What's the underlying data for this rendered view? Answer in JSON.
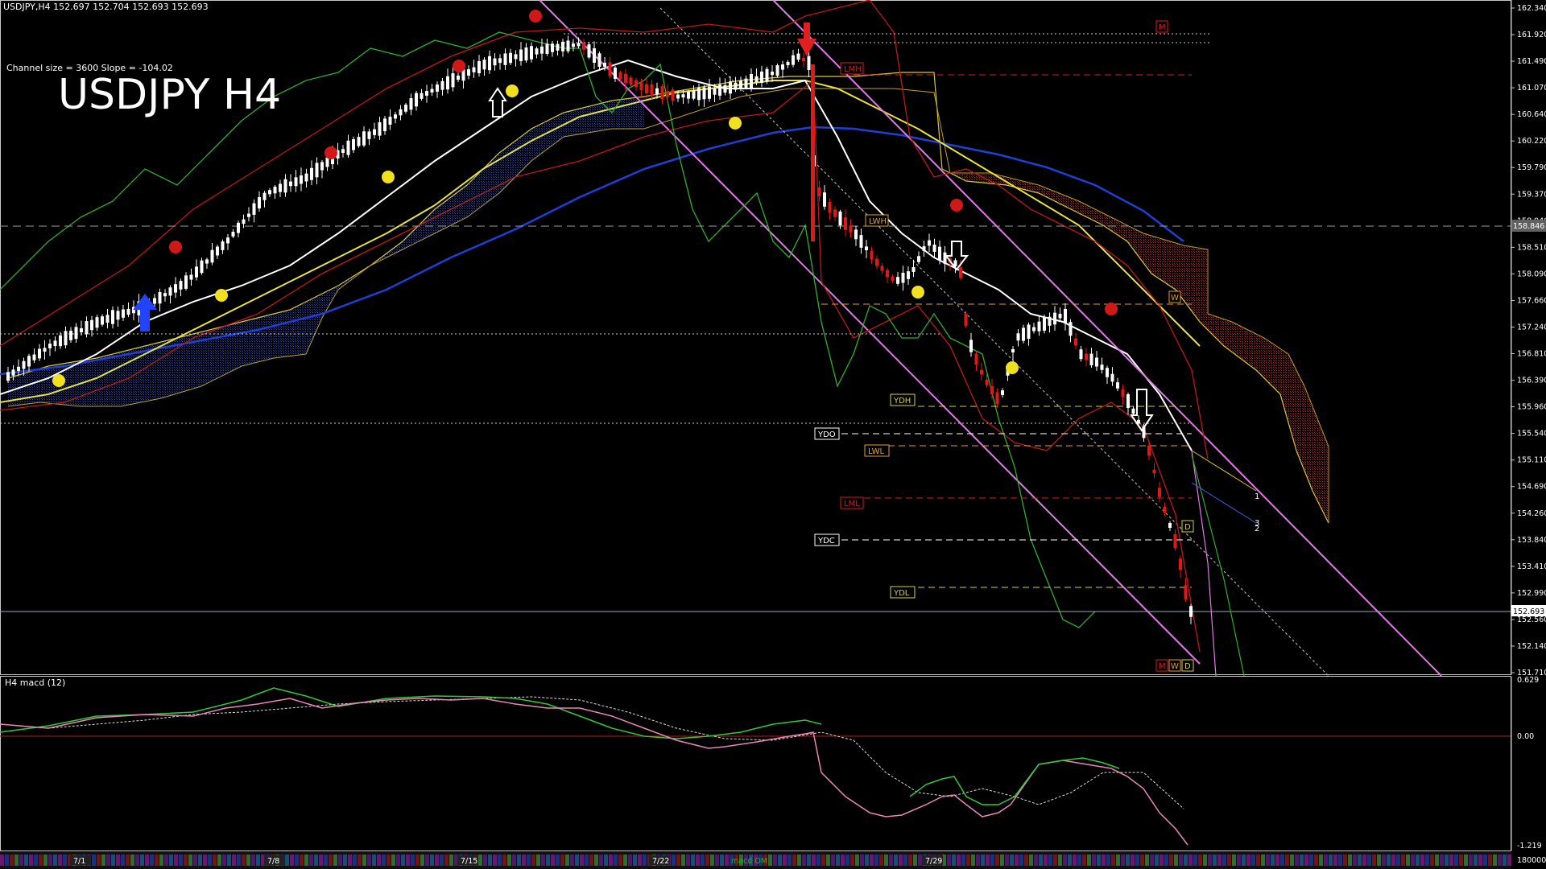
{
  "header": {
    "title_line": "USDJPY,H4  152.697 152.704 152.693 152.693",
    "channel_info": "Channel size = 3600 Slope = -104.02",
    "big_title": "USDJPY H4"
  },
  "price_axis": {
    "ticks": [
      "162.340",
      "161.920",
      "161.490",
      "161.070",
      "160.640",
      "160.220",
      "159.790",
      "159.370",
      "158.940",
      "158.510",
      "158.090",
      "157.660",
      "157.240",
      "156.810",
      "156.390",
      "155.960",
      "155.540",
      "155.110",
      "154.690",
      "154.260",
      "153.840",
      "153.410",
      "152.990",
      "152.560",
      "152.140",
      "151.710"
    ],
    "current_price": "152.693",
    "hline_price": "158.846"
  },
  "macd_panel": {
    "title": "H4  macd (12)",
    "ticks": [
      "0.629",
      "0.00",
      "-1.219",
      "180000"
    ],
    "footer_label": "macd OM"
  },
  "time_axis": {
    "labels": [
      "7/1",
      "7/8",
      "7/15",
      "7/22",
      "7/29"
    ]
  },
  "level_labels": {
    "lmh": "LMH",
    "lwh": "LWH",
    "ydh": "YDH",
    "ydo": "YDO",
    "lwl": "LWL",
    "lml": "LML",
    "ydc": "YDC",
    "ydl": "YDL",
    "m_top": "M",
    "w_right": "W",
    "d_right": "D",
    "m_bottom": "M",
    "w_bottom": "W",
    "d_bottom": "D",
    "num_1": "1",
    "num_2": "2",
    "num_3": "3"
  },
  "colors": {
    "background": "#000000",
    "ma_white": "#ffffff",
    "ma_yellow": "#e8e23a",
    "ma_blue": "#1f3fd6",
    "channel_magenta": "#e07ae6",
    "bollinger_red": "#c01818",
    "chikou_green": "#2fae2f",
    "cloud_blue": "#1b3fb5",
    "cloud_red": "#b51b1b",
    "macd_green": "#35c835",
    "macd_pink": "#e986b8"
  },
  "chart_data": {
    "type": "candlestick",
    "symbol": "USDJPY",
    "timeframe": "H4",
    "ylim": [
      151.71,
      162.34
    ],
    "last": 152.693,
    "levels": {
      "LMH": 161.3,
      "LWH": 158.95,
      "YDH": 155.95,
      "YDO": 155.56,
      "LWL": 155.35,
      "LML": 154.55,
      "YDC": 153.87,
      "YDL": 153.15
    },
    "macd_ylim": [
      -1.219,
      0.629
    ]
  }
}
